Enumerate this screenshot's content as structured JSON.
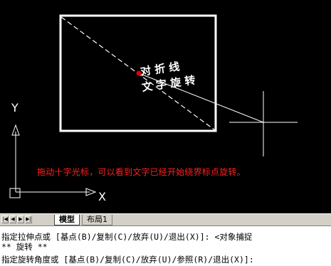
{
  "drawing": {
    "text_row1": "对 折 线",
    "text_row2": "文 字 旋 转",
    "axis_y": "Y",
    "axis_x": "X",
    "caption": "拖动十字光标，可以看到文字已经开始绕界标点旋转。"
  },
  "colors": {
    "background": "#000000",
    "geometry": "#ffffff",
    "caption": "#ff2020",
    "base_point": "#e00000"
  },
  "nav": [
    "first-icon",
    "prev-icon",
    "next-icon",
    "last-icon"
  ],
  "tabs": [
    {
      "label": "模型",
      "active": true
    },
    {
      "label": "布局1",
      "active": false
    }
  ],
  "command": {
    "line1": "指定拉伸点或 [基点(B)/复制(C)/放弃(U)/退出(X)]: <对象捕捉",
    "line2": "** 旋转 **",
    "line3": "指定旋转角度或 [基点(B)/复制(C)/放弃(U)/参照(R)/退出(X)]:"
  }
}
